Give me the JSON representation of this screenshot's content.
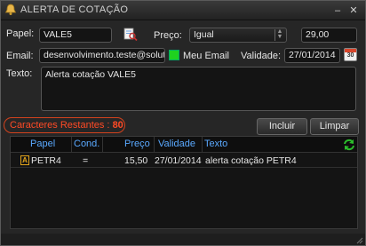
{
  "window": {
    "title": "ALERTA DE COTAÇÃO",
    "minimize_glyph": "–",
    "close_glyph": "✕"
  },
  "form": {
    "papel_label": "Papel:",
    "papel_value": "VALE5",
    "preco_label": "Preço:",
    "operator_value": "Igual",
    "price_value": "29,00",
    "email_label": "Email:",
    "email_value": "desenvolvimento.teste@soluti",
    "meu_email_label": "Meu Email",
    "validade_label": "Validade:",
    "validade_value": "27/01/2014",
    "calendar_day": "30",
    "texto_label": "Texto:",
    "texto_value": "Alerta cotação VALE5"
  },
  "counter": {
    "label": "Caracteres Restantes :",
    "value": "80"
  },
  "buttons": {
    "incluir": "Incluir",
    "limpar": "Limpar"
  },
  "table": {
    "headers": [
      "Papel",
      "Cond.",
      "Preço",
      "Validade",
      "Texto"
    ],
    "rows": [
      {
        "icon_letter": "A",
        "papel": "PETR4",
        "cond": "=",
        "preco": "15,50",
        "validade": "27/01/2014",
        "texto": "alerta cotação PETR4"
      }
    ]
  },
  "colors": {
    "accent_blue": "#5aa9ff",
    "counter_red": "#ff4a25",
    "meu_email_green": "#1fd11f",
    "refresh_green": "#2bbd2b"
  }
}
